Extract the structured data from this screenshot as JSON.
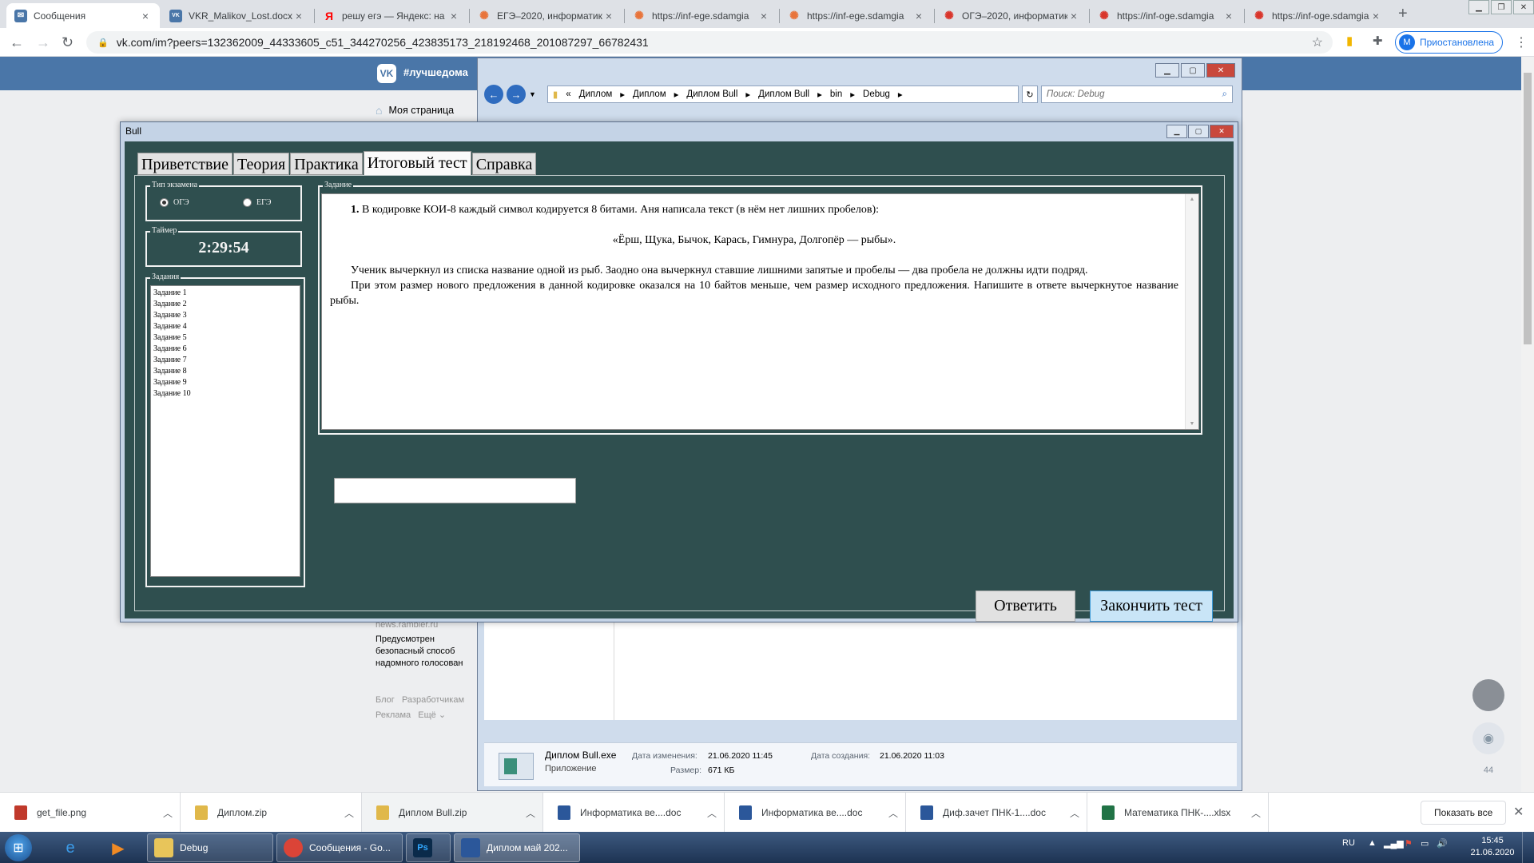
{
  "browser": {
    "tabs": [
      {
        "label": "Сообщения",
        "color": "#4a76a8",
        "glyph": "✉"
      },
      {
        "label": "VKR_Malikov_Lost.docx",
        "color": "#4a76a8",
        "glyph": "VK"
      },
      {
        "label": "решу егэ — Яндекс: на",
        "color": "#ff0000",
        "glyph": "Я"
      },
      {
        "label": "ЕГЭ–2020, информатик",
        "color": "#e8743b",
        "glyph": "✺"
      },
      {
        "label": "https://inf-ege.sdamgia",
        "color": "#e8743b",
        "glyph": "✺"
      },
      {
        "label": "https://inf-ege.sdamgia",
        "color": "#e8743b",
        "glyph": "✺"
      },
      {
        "label": "ОГЭ–2020, информатик",
        "color": "#d9352b",
        "glyph": "✺"
      },
      {
        "label": "https://inf-oge.sdamgia",
        "color": "#d9352b",
        "glyph": "✺"
      },
      {
        "label": "https://inf-oge.sdamgia",
        "color": "#d9352b",
        "glyph": "✺"
      }
    ],
    "url": "vk.com/im?peers=132362009_44333605_c51_344270256_423835173_218192468_201087297_66782431",
    "profile_initial": "M",
    "profile_label": "Приостановлена"
  },
  "vk": {
    "hashtag": "#лучшедома",
    "my_page": "Моя страница",
    "news_source": "news.rambler.ru",
    "news_text": "Предусмотрен безопасный способ надомного голосован",
    "footer_links": [
      "Блог",
      "Разработчикам",
      "Реклама",
      "Ещё ⌄"
    ],
    "online_count": "44"
  },
  "explorer": {
    "path": [
      "«",
      "Диплом",
      "Диплом",
      "Диплом Bull",
      "Диплом Bull",
      "bin",
      "Debug"
    ],
    "search_placeholder": "Поиск: Debug",
    "file": {
      "name": "Диплом Bull.exe",
      "type": "Приложение",
      "modified_label": "Дата изменения:",
      "modified": "21.06.2020 11:45",
      "created_label": "Дата создания:",
      "created": "21.06.2020 11:03",
      "size_label": "Размер:",
      "size": "671 КБ"
    }
  },
  "app": {
    "title": "Bull",
    "tabs": [
      "Приветствие",
      "Теория",
      "Практика",
      "Итоговый тест",
      "Справка"
    ],
    "active_tab": 3,
    "exam_group": "Тип экзамена",
    "exam_options": [
      {
        "label": "ОГЭ",
        "selected": true
      },
      {
        "label": "ЕГЭ",
        "selected": false
      }
    ],
    "timer_group": "Таймер",
    "timer": "2:29:54",
    "tasks_group": "Задания",
    "tasks": [
      "Задание 1",
      "Задание 2",
      "Задание 3",
      "Задание 4",
      "Задание 5",
      "Задание 6",
      "Задание 7",
      "Задание 8",
      "Задание 9",
      "Задание 10"
    ],
    "question_group": "Задание",
    "question": {
      "number": "1.",
      "line1": "В кодировке КОИ-8 каждый символ кодируется 8 битами. Аня написала текст (в нём нет лишних пробелов):",
      "quote": "«Ёрш, Щука, Бычок, Карась, Гимнура, Долгопёр — рыбы».",
      "para2": "Ученик вычеркнул из списка название одной из рыб. Заодно она вычеркнул ставшие лишними запятые и пробелы — два пробела не должны идти подряд.",
      "para3": "При этом размер нового предложения в данной кодировке оказался на 10 байтов меньше, чем размер исходного предложения. Напишите в ответе вычеркнутое название рыбы."
    },
    "answer_value": "",
    "answer_button": "Ответить",
    "finish_button": "Закончить тест"
  },
  "downloads": [
    {
      "name": "get_file.png",
      "color": "#c0392b"
    },
    {
      "name": "Диплом.zip",
      "color": "#e0b84a"
    },
    {
      "name": "Диплом Bull.zip",
      "color": "#e0b84a"
    },
    {
      "name": "Информатика ве....doc",
      "color": "#2b579a"
    },
    {
      "name": "Информатика ве....doc",
      "color": "#2b579a"
    },
    {
      "name": "Диф.зачет ПНК-1....doc",
      "color": "#2b579a"
    },
    {
      "name": "Математика ПНК-....xlsx",
      "color": "#217346"
    }
  ],
  "show_all": "Показать все",
  "taskbar": {
    "items": [
      {
        "label": "Debug",
        "color": "#e8c55a"
      },
      {
        "label": "Сообщения - Go...",
        "color": "#db4437"
      },
      {
        "label": "",
        "color": "#0a2a4a"
      },
      {
        "label": "Диплом май 202...",
        "color": "#2b579a"
      }
    ],
    "lang": "RU",
    "time": "15:45",
    "date": "21.06.2020"
  }
}
